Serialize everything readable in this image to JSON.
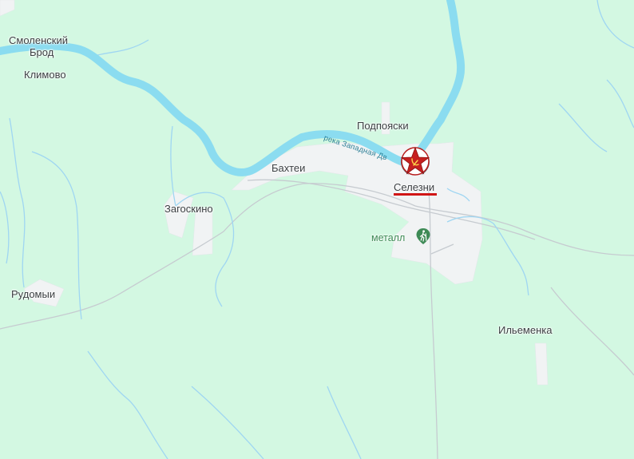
{
  "map": {
    "colors": {
      "land": "#d3f8e2",
      "river": "#8bdcf0",
      "stream": "#9fd6f2",
      "settlement": "#f1f3f4",
      "road": "#c6cbd0",
      "poi": "#3d8a55",
      "highlight": "#d01515"
    },
    "places": {
      "smolensky_brod_line1": "Смоленский",
      "smolensky_brod_line2": "Брод",
      "klimovo": "Климово",
      "podpoyaski": "Подпояски",
      "bakhtei": "Бахтеи",
      "zagoskino": "Загоскино",
      "rudomyi": "Рудомыи",
      "ilmenka": "Ильеменка",
      "selezni": "Селезни"
    },
    "river_label": "река Западная Дв",
    "poi": {
      "label": "металл",
      "icon": "hiking-icon"
    },
    "selected_marker_icon": "red-star-wreath-icon"
  }
}
